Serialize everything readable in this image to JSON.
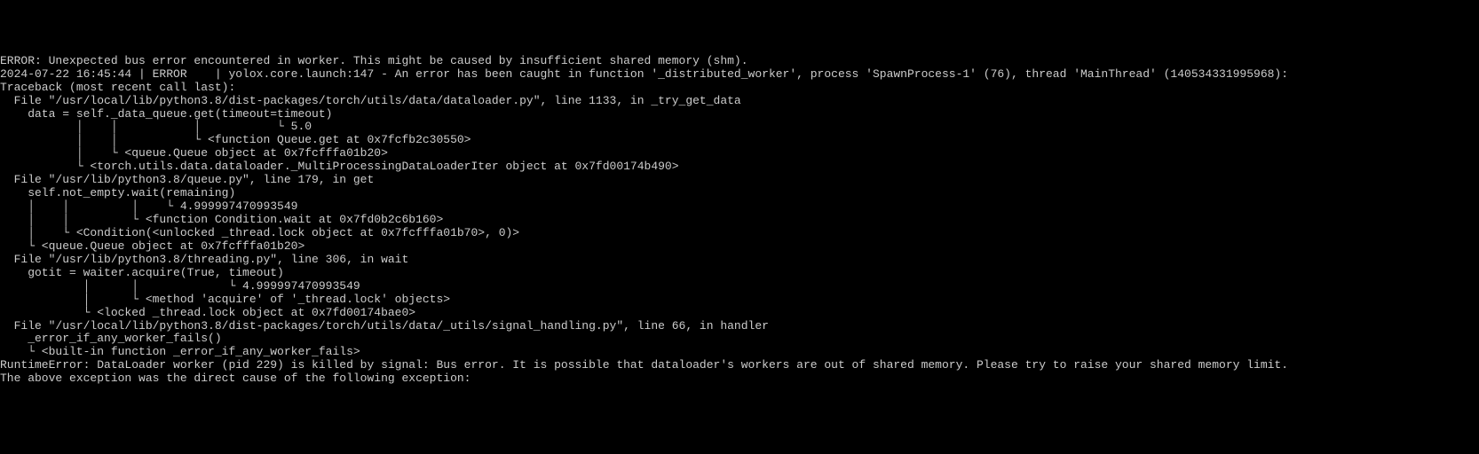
{
  "lines": {
    "l0": "ERROR: Unexpected bus error encountered in worker. This might be caused by insufficient shared memory (shm).",
    "l1": "2024-07-22 16:45:44 | ERROR    | yolox.core.launch:147 - An error has been caught in function '_distributed_worker', process 'SpawnProcess-1' (76), thread 'MainThread' (140534331995968):",
    "l2": "Traceback (most recent call last):",
    "l3": "",
    "l4": "  File \"/usr/local/lib/python3.8/dist-packages/torch/utils/data/dataloader.py\", line 1133, in _try_get_data",
    "l5": "    data = self._data_queue.get(timeout=timeout)",
    "l6": "           │    │           │           └ 5.0",
    "l7": "           │    │           └ <function Queue.get at 0x7fcfb2c30550>",
    "l8": "           │    └ <queue.Queue object at 0x7fcfffa01b20>",
    "l9": "           └ <torch.utils.data.dataloader._MultiProcessingDataLoaderIter object at 0x7fd00174b490>",
    "l10": "",
    "l11": "  File \"/usr/lib/python3.8/queue.py\", line 179, in get",
    "l12": "    self.not_empty.wait(remaining)",
    "l13": "    │    │         │    └ 4.999997470993549",
    "l14": "    │    │         └ <function Condition.wait at 0x7fd0b2c6b160>",
    "l15": "    │    └ <Condition(<unlocked _thread.lock object at 0x7fcfffa01b70>, 0)>",
    "l16": "    └ <queue.Queue object at 0x7fcfffa01b20>",
    "l17": "  File \"/usr/lib/python3.8/threading.py\", line 306, in wait",
    "l18": "    gotit = waiter.acquire(True, timeout)",
    "l19": "            │      │             └ 4.999997470993549",
    "l20": "            │      └ <method 'acquire' of '_thread.lock' objects>",
    "l21": "            └ <locked _thread.lock object at 0x7fd00174bae0>",
    "l22": "",
    "l23": "  File \"/usr/local/lib/python3.8/dist-packages/torch/utils/data/_utils/signal_handling.py\", line 66, in handler",
    "l24": "    _error_if_any_worker_fails()",
    "l25": "    └ <built-in function _error_if_any_worker_fails>",
    "l26": "",
    "l27": "RuntimeError: DataLoader worker (pid 229) is killed by signal: Bus error. It is possible that dataloader's workers are out of shared memory. Please try to raise your shared memory limit.",
    "l28": "",
    "l29": "",
    "l30": "The above exception was the direct cause of the following exception:"
  }
}
